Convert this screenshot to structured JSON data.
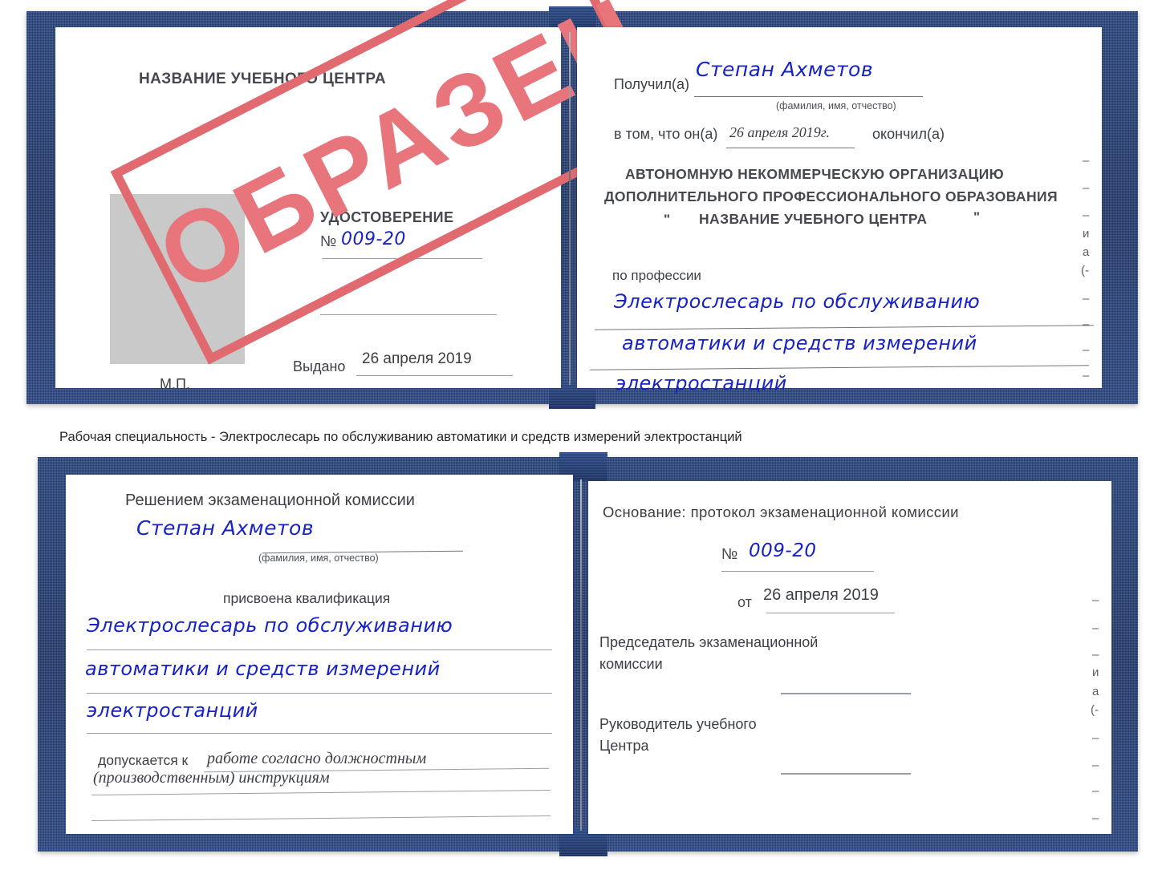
{
  "caption": {
    "text": "Рабочая специальность - Электрослесарь по обслуживанию автоматики и средств измерений электростанций"
  },
  "watermark": {
    "label": "ОБРАЗЕЦ",
    "color": "#e8757b",
    "border_color": "#e06a70"
  },
  "colors": {
    "cover_blue": "#1d3569",
    "handwriting_blue": "#1722c4",
    "paper_white": "#ffffff",
    "photo_placeholder_gray": "#c9c9c9",
    "rule_gray": "#9a9ea4",
    "print_text": "#3b3f45"
  },
  "certificate_1": {
    "left_page": {
      "center_name": "НАЗВАНИЕ УЧЕБНОГО ЦЕНТРА",
      "doc_type": "УДОСТОВЕРЕНИЕ",
      "number_label": "№",
      "number_value": "009-20",
      "issued_label": "Выдано",
      "issued_value": "26 апреля 2019",
      "seal_label": "М.П."
    },
    "right_page": {
      "received_label": "Получил(а)",
      "received_value": "Степан Ахметов",
      "name_hint": "(фамилия, имя, отчество)",
      "in_that_label": "в том, что он(а)",
      "finish_date_value": "26 апреля 2019г.",
      "finished_label": "окончил(а)",
      "org_line1": "АВТОНОМНУЮ НЕКОММЕРЧЕСКУЮ ОРГАНИЗАЦИЮ",
      "org_line2": "ДОПОЛНИТЕЛЬНОГО ПРОФЕССИОНАЛЬНОГО ОБРАЗОВАНИЯ",
      "org_quote_open": "\"",
      "org_line3": "НАЗВАНИЕ УЧЕБНОГО ЦЕНТРА",
      "org_quote_close": "\"",
      "profession_label": "по профессии",
      "profession_line1": "Электрослесарь по обслуживанию",
      "profession_line2": "автоматики и средств измерений",
      "profession_line3": "электростанций",
      "edge_ghosts": [
        "–",
        "–",
        "–",
        "и",
        "а",
        "(-",
        "–",
        "–",
        "–",
        "–"
      ]
    }
  },
  "certificate_2": {
    "left_page": {
      "decision_title": "Решением экзаменационной комиссии",
      "name_value": "Степан Ахметов",
      "name_hint": "(фамилия, имя, отчество)",
      "qualification_label": "присвоена квалификация",
      "qualification_line1": "Электрослесарь по обслуживанию",
      "qualification_line2": "автоматики и средств измерений",
      "qualification_line3": "электростанций",
      "admitted_label": "допускается к",
      "admitted_value_line1": "работе согласно должностным",
      "admitted_value_line2": "(производственным) инструкциям"
    },
    "right_page": {
      "basis_label": "Основание: протокол экзаменационной комиссии",
      "protocol_number_label": "№",
      "protocol_number_value": "009-20",
      "protocol_date_label": "от",
      "protocol_date_value": "26 апреля 2019",
      "chairman_line1": "Председатель экзаменационной",
      "chairman_line2": "комиссии",
      "head_line1": "Руководитель учебного",
      "head_line2": "Центра",
      "edge_ghosts": [
        "–",
        "–",
        "–",
        "и",
        "а",
        "(-",
        "–",
        "–",
        "–",
        "–"
      ]
    }
  }
}
